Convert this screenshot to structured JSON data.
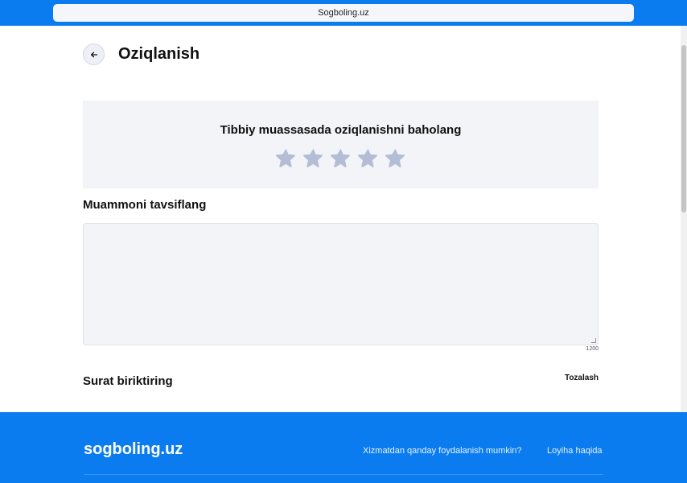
{
  "browser": {
    "url": "Sogboling.uz"
  },
  "header": {
    "title": "Oziqlanish"
  },
  "rating": {
    "title": "Tibbiy muassasada oziqlanishni baholang",
    "stars_total": 5,
    "stars_selected": 0,
    "star_color": "#b4bdd6"
  },
  "description": {
    "label": "Muammoni tavsiflang",
    "value": "",
    "counter": "1200"
  },
  "attach": {
    "label": "Surat biriktiring",
    "clear_label": "Tozalash"
  },
  "footer": {
    "logo": "sogboling.uz",
    "links": [
      "Xizmatdan qanday foydalanish mumkin?",
      "Loyiha haqida"
    ]
  },
  "colors": {
    "accent": "#0a7cf0",
    "panel": "#f3f4f8"
  }
}
